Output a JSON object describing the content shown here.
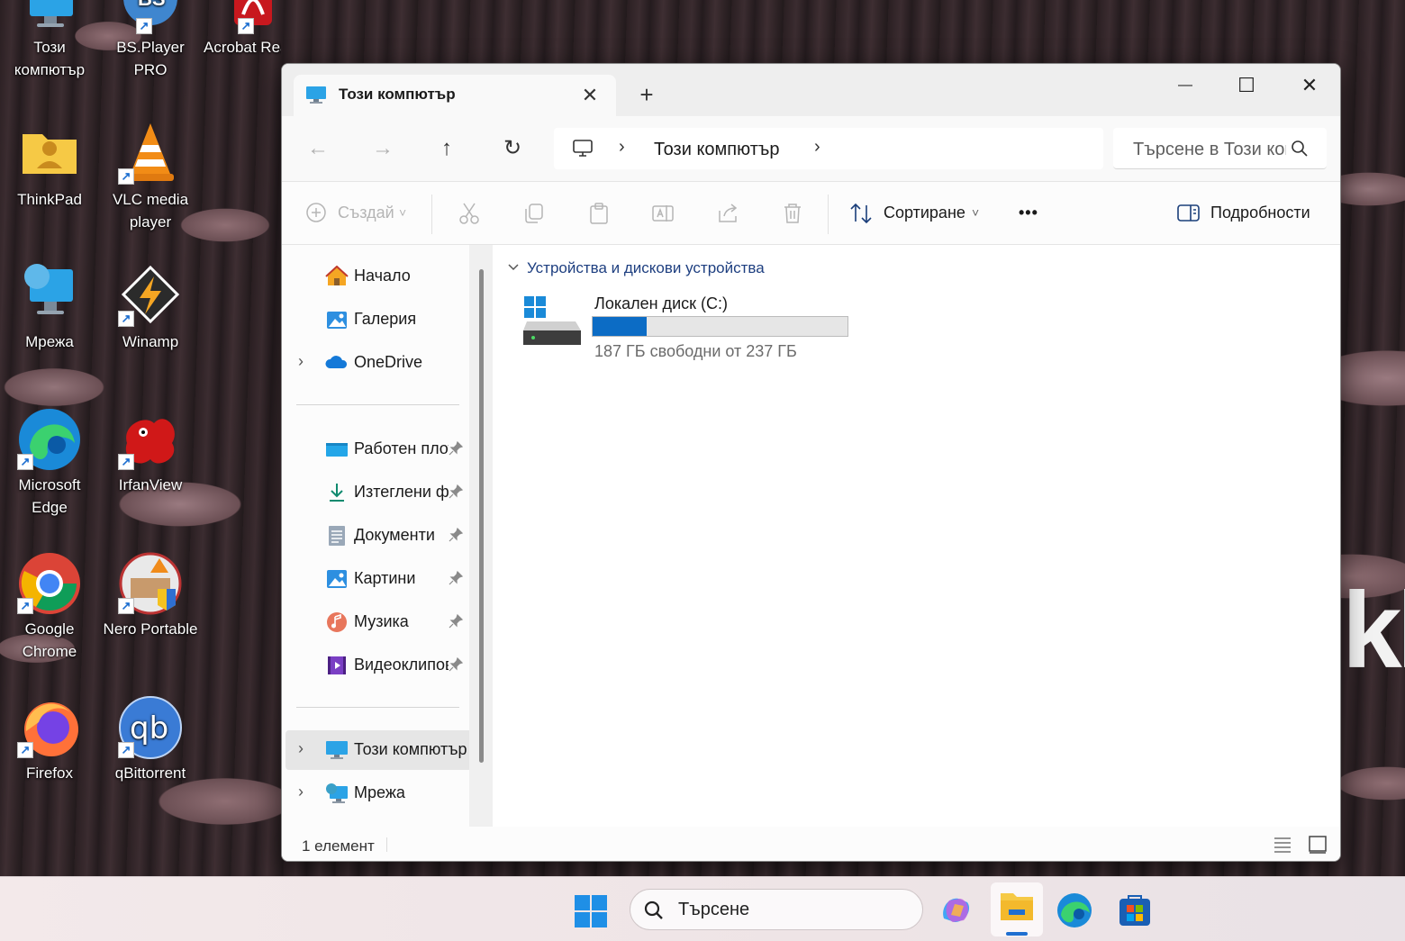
{
  "desktop": {
    "icons": [
      {
        "label": "Този компютър",
        "icon": "computer-icon",
        "shortcut": false
      },
      {
        "label": "BS.Player PRO",
        "icon": "bsplayer-icon",
        "shortcut": true
      },
      {
        "label": "Acrobat Reader DC",
        "icon": "acrobat-icon",
        "shortcut": true
      },
      {
        "label": "ThinkPad",
        "icon": "user-folder-icon",
        "shortcut": false
      },
      {
        "label": "VLC media player",
        "icon": "vlc-icon",
        "shortcut": true
      },
      {
        "label": "Мрежа",
        "icon": "network-icon",
        "shortcut": false
      },
      {
        "label": "Winamp",
        "icon": "winamp-icon",
        "shortcut": true
      },
      {
        "label": "Microsoft Edge",
        "icon": "edge-icon",
        "shortcut": true
      },
      {
        "label": "IrfanView",
        "icon": "irfanview-icon",
        "shortcut": true
      },
      {
        "label": "Google Chrome",
        "icon": "chrome-icon",
        "shortcut": true
      },
      {
        "label": "Nero Portable",
        "icon": "nero-icon",
        "shortcut": true
      },
      {
        "label": "Firefox",
        "icon": "firefox-icon",
        "shortcut": true
      },
      {
        "label": "qBittorrent",
        "icon": "qbittorrent-icon",
        "shortcut": true
      }
    ]
  },
  "window": {
    "tab_title": "Този компютър",
    "tab_close": "✕",
    "new_tab": "+",
    "controls": {
      "minimize": "—",
      "maximize": "☐",
      "close": "✕"
    }
  },
  "nav": {
    "back": "←",
    "forward": "→",
    "up": "↑",
    "refresh": "↻",
    "address_chevron": "›",
    "address_text": "Този компютър",
    "search_placeholder": "Търсене в Този компютър"
  },
  "commands": {
    "create": "Създай",
    "sort": "Сортиране",
    "more": "•••",
    "details": "Подробности",
    "dropdown": "˅"
  },
  "sidebar": {
    "items": [
      {
        "label": "Начало",
        "icon": "home-icon"
      },
      {
        "label": "Галерия",
        "icon": "gallery-icon"
      },
      {
        "label": "OneDrive",
        "icon": "onedrive-icon"
      },
      {
        "label": "Работен плот",
        "icon": "desktop-folder-icon",
        "pinned": true
      },
      {
        "label": "Изтеглени файлове",
        "icon": "downloads-icon",
        "pinned": true
      },
      {
        "label": "Документи",
        "icon": "documents-icon",
        "pinned": true
      },
      {
        "label": "Картини",
        "icon": "pictures-icon",
        "pinned": true
      },
      {
        "label": "Музика",
        "icon": "music-icon",
        "pinned": true
      },
      {
        "label": "Видеоклипове",
        "icon": "videos-icon",
        "pinned": true
      },
      {
        "label": "Този компютър",
        "icon": "computer-icon",
        "selected": true
      },
      {
        "label": "Мрежа",
        "icon": "network-icon"
      }
    ],
    "expand_chevron": "›"
  },
  "content": {
    "group_title": "Устройства и дискови устройства",
    "drive": {
      "name": "Локален диск (C:)",
      "free_text": "187 ГБ свободни от 237 ГБ",
      "used_fraction": 0.211
    }
  },
  "status": {
    "count_text": "1 елемент"
  },
  "taskbar": {
    "search_placeholder": "Търсене"
  },
  "colors": {
    "accent": "#0c6cc5",
    "selected_bg": "#e6e6e6",
    "group_title": "#1e3f80"
  }
}
